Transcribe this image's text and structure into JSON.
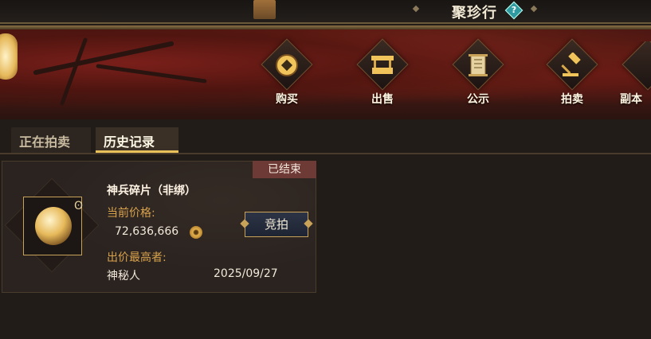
{
  "header": {
    "title": "聚珍行",
    "help_icon": "?"
  },
  "nav": {
    "items": [
      {
        "label": "购买",
        "icon": "coin-icon"
      },
      {
        "label": "出售",
        "icon": "stall-icon"
      },
      {
        "label": "公示",
        "icon": "scroll-icon"
      },
      {
        "label": "拍卖",
        "icon": "gavel-icon"
      },
      {
        "label": "副本",
        "icon": "more-icon"
      }
    ]
  },
  "tabs": {
    "live": "正在拍卖",
    "history": "历史记录",
    "active": "history"
  },
  "auction_card": {
    "status": "已结束",
    "item_name": "神兵碎片（非绑）",
    "bind_icon": "ʘ",
    "price_label": "当前价格:",
    "price": "72,636,666",
    "bidder_label": "出价最高者:",
    "bidder": "神秘人",
    "date": "2025/09/27",
    "bid_button": "竞拍"
  },
  "colors": {
    "accent_gold": "#e8c15a",
    "label_gold": "#d9a24c",
    "ended_badge": "#6e3a36",
    "button_blue": "#2c3446"
  }
}
